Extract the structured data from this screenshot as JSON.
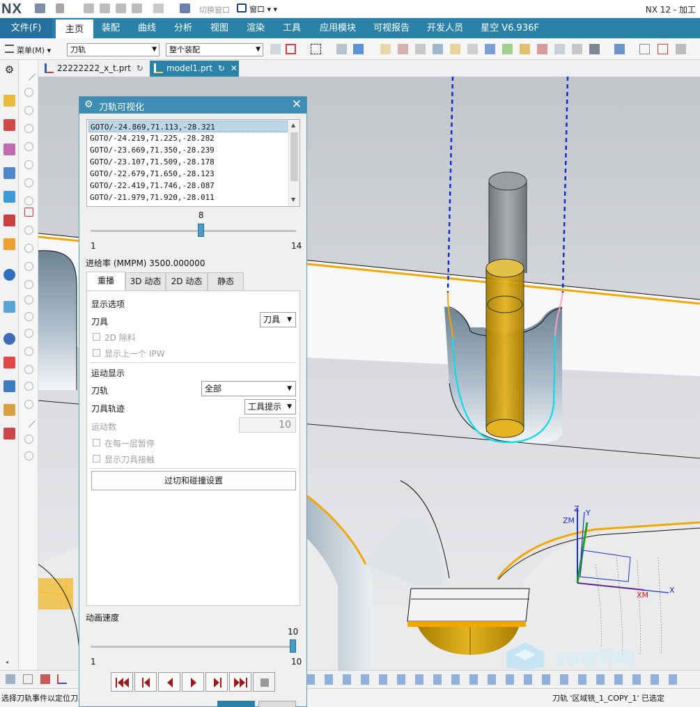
{
  "app": {
    "logo": "NX",
    "title": "NX 12 - 加工",
    "quick_access": {
      "switch_window": "切换窗口",
      "window": "窗口"
    }
  },
  "ribbon": {
    "file": "文件(F)",
    "tabs": [
      "主页",
      "装配",
      "曲线",
      "分析",
      "视图",
      "渲染",
      "工具",
      "应用模块",
      "可视报告",
      "开发人员",
      "星空 V6.936F"
    ]
  },
  "toolbar": {
    "menu": "菜单(M)",
    "filter_select": "刀轨",
    "scope_select": "整个装配"
  },
  "documents": [
    {
      "name": "22222222_x_t.prt"
    },
    {
      "name": "model1.prt"
    }
  ],
  "dialog": {
    "title": "刀轨可视化",
    "goto_lines": [
      "GOTO/-24.869,71.113,-28.321",
      "GOTO/-24.219,71.225,-28.282",
      "GOTO/-23.669,71.350,-28.239",
      "GOTO/-23.107,71.509,-28.178",
      "GOTO/-22.679,71.650,-28.123",
      "GOTO/-22.419,71.746,-28.087",
      "GOTO/-21.979,71.920,-28.011"
    ],
    "step_slider": {
      "value": 8,
      "min": 1,
      "max": 14
    },
    "feed_rate_label": "进给率 (MMPM) 3500.000000",
    "tabs": [
      "重播",
      "3D 动态",
      "2D 动态",
      "静态"
    ],
    "display_options": {
      "heading": "显示选项",
      "tool_label": "刀具",
      "tool_value": "刀具",
      "chk_2d_removal": "2D 除料",
      "chk_prev_ipw": "显示上一个 IPW"
    },
    "motion_display": {
      "heading": "运动显示",
      "toolpath_label": "刀轨",
      "toolpath_value": "全部",
      "trace_label": "刀具轨迹",
      "trace_value": "工具提示",
      "motion_count_label": "运动数",
      "motion_count_value": "10",
      "chk_pause_each_layer": "在每一层暂停",
      "chk_show_contact": "显示刀具接触"
    },
    "gouge_button": "过切和碰撞设置",
    "anim_speed": {
      "label": "动画速度",
      "value": 10,
      "min": 1,
      "max": 10
    }
  },
  "viewport": {
    "triad": {
      "z": "Z",
      "zm": "ZM",
      "y": "Y",
      "xm": "XM",
      "x": "X"
    },
    "watermark": "3D世界网",
    "colors": {
      "toolpath_rapid": "#0a2fd6",
      "toolpath_cut": "#19d9e8",
      "tool_holder": "#8a8d92",
      "tool_cutter": "#d8a400",
      "edge_highlight": "#f2a800"
    }
  },
  "status": {
    "left": "选择刀轨事件以定位刀具",
    "right": "刀轨 '区域铣_1_COPY_1' 已选定"
  }
}
